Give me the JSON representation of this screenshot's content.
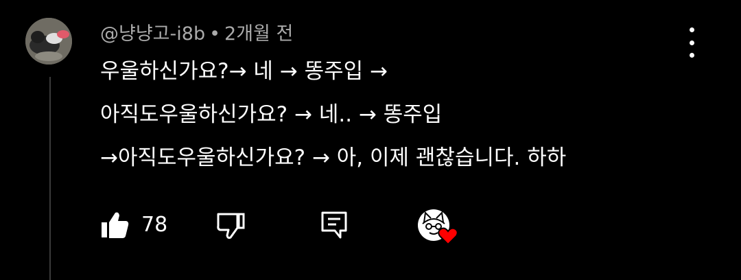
{
  "comment": {
    "author": "@냥냥고-i8b",
    "separator": "•",
    "time": "2개월 전",
    "lines": [
      "우울하신가요?→ 네 → 똥주입 →",
      "아직도우울하신가요? → 네.. → 똥주입",
      "→아직도우울하신가요? → 아, 이제 괜찮습니다. 하하"
    ]
  },
  "actions": {
    "like_count": "78"
  },
  "icons": {
    "like": "thumbs-up-icon",
    "dislike": "thumbs-down-icon",
    "reply": "reply-comment-icon",
    "more": "more-vertical-icon",
    "creator_heart": "heart-icon"
  },
  "colors": {
    "background": "#000000",
    "text": "#ffffff",
    "meta_text": "#aaaaaa",
    "heart": "#ff0000"
  }
}
